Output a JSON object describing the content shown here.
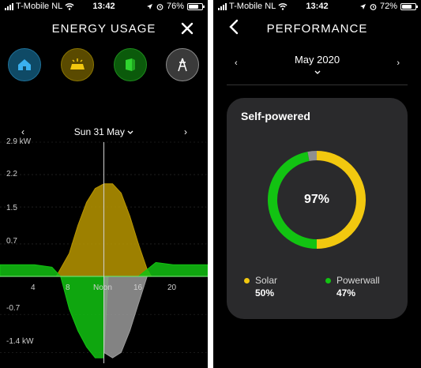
{
  "energy_screen": {
    "status": {
      "carrier": "T-Mobile NL",
      "time": "13:42",
      "battery": "76%",
      "battery_level": 0.76
    },
    "title": "ENERGY USAGE",
    "icons": [
      "home-icon",
      "solar-panel-icon",
      "powerwall-icon",
      "grid-tower-icon"
    ],
    "day_nav": {
      "label": "Sun 31 May",
      "prev": "‹",
      "next": "›"
    },
    "chart": {
      "y_ticks": [
        "2.9 kW",
        "2.2",
        "1.5",
        "0.7",
        "-0.7",
        "-1.4 kW"
      ],
      "x_ticks": [
        "4",
        "8",
        "Noon",
        "16",
        "20"
      ]
    }
  },
  "performance_screen": {
    "status": {
      "carrier": "T-Mobile NL",
      "time": "13:42",
      "battery": "72%",
      "battery_level": 0.72
    },
    "title": "PERFORMANCE",
    "month_nav": {
      "label": "May 2020",
      "prev": "‹",
      "next": "›"
    },
    "card": {
      "title": "Self-powered",
      "center_value": "97%",
      "legend": [
        {
          "name": "Solar",
          "value": "50%",
          "color": "#f2c80f"
        },
        {
          "name": "Powerwall",
          "value": "47%",
          "color": "#12c312"
        }
      ],
      "grid_share": 0.03
    }
  },
  "chart_data": {
    "type": "area",
    "title": "",
    "x_ticks": [
      "4",
      "8",
      "Noon",
      "16",
      "20"
    ],
    "y_ticks": [
      2.9,
      2.2,
      1.5,
      0.7,
      -0.7,
      -1.4
    ],
    "ylim": [
      -1.6,
      2.9
    ],
    "xlim": [
      0,
      24
    ],
    "series": [
      {
        "name": "Solar",
        "color": "#b99600",
        "x": [
          6.5,
          8,
          9,
          10,
          11,
          12,
          13,
          14,
          15,
          16,
          17,
          17.5
        ],
        "values": [
          0,
          0.5,
          1.1,
          1.6,
          1.9,
          2.0,
          2.0,
          1.8,
          1.3,
          0.7,
          0.15,
          0
        ]
      },
      {
        "name": "Powerwall",
        "color": "#12c312",
        "x": [
          0,
          2,
          4,
          6,
          7,
          8,
          9,
          10,
          11,
          12,
          12.5,
          13,
          14,
          16,
          18,
          20,
          22,
          24
        ],
        "values": [
          0.25,
          0.25,
          0.25,
          0.2,
          0,
          -0.6,
          -1.0,
          -1.3,
          -1.5,
          -1.5,
          0,
          0,
          0,
          0,
          0.3,
          0.25,
          0.25,
          0.25
        ]
      },
      {
        "name": "Grid",
        "color": "#9a9a9a",
        "x": [
          12,
          13,
          14,
          15,
          16,
          17
        ],
        "values": [
          -1.4,
          -1.5,
          -1.4,
          -1.0,
          -0.5,
          0
        ]
      }
    ]
  }
}
